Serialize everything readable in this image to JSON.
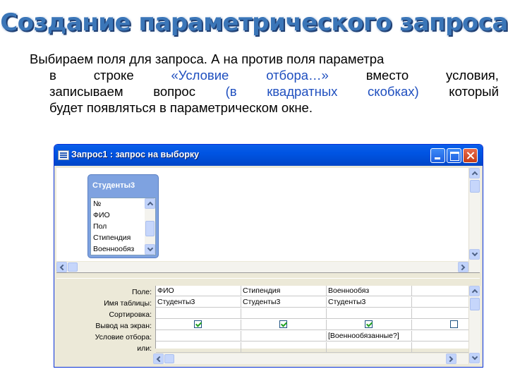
{
  "slide": {
    "title": "Создание параметрического запроса",
    "text_lines": [
      "Выбираем поля для запроса. А на против поля параметра",
      [
        "в",
        "строке",
        "«Условие",
        "отбора…»",
        "вместо",
        "условия,"
      ],
      [
        "записываем",
        "вопрос",
        "(в",
        "квадратных",
        "скобках)",
        "который"
      ],
      "будет появляться в параметрическом окне."
    ]
  },
  "window": {
    "title": "Запрос1 : запрос на выборку",
    "table": {
      "name": "Студенты3",
      "fields": [
        "№",
        "ФИО",
        "Пол",
        "Стипендия",
        "Военнообяз"
      ]
    },
    "grid": {
      "row_labels": [
        "Поле:",
        "Имя таблицы:",
        "Сортировка:",
        "Вывод на экран:",
        "Условие отбора:",
        "или:"
      ],
      "columns": [
        {
          "field": "ФИО",
          "table": "Студенты3",
          "sort": "",
          "show": true,
          "criteria": "",
          "or": ""
        },
        {
          "field": "Стипендия",
          "table": "Студенты3",
          "sort": "",
          "show": true,
          "criteria": "",
          "or": ""
        },
        {
          "field": "Военнообяз",
          "table": "Студенты3",
          "sort": "",
          "show": true,
          "criteria": "[Военнообязанные?]",
          "or": ""
        },
        {
          "field": "",
          "table": "",
          "sort": "",
          "show": false,
          "criteria": "",
          "or": ""
        }
      ]
    }
  }
}
